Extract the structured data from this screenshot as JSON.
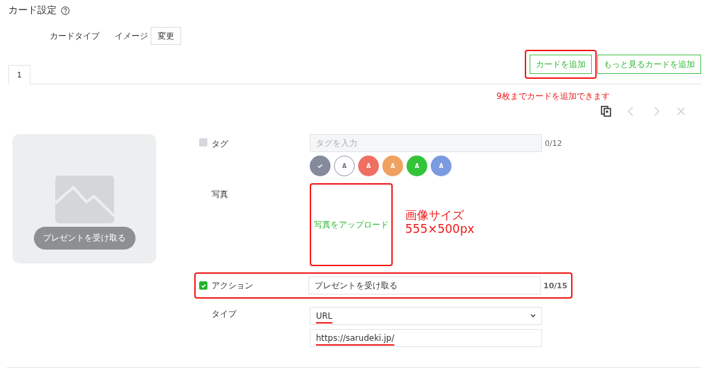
{
  "title": "カード設定",
  "card_type": {
    "label": "カードタイプ",
    "value": "イメージ",
    "change_button": "変更"
  },
  "tabs": [
    {
      "label": "1",
      "selected": true
    }
  ],
  "add_buttons": [
    {
      "label": "カードを追加",
      "highlighted": true
    },
    {
      "label": "もっと見るカードを追加",
      "highlighted": false
    }
  ],
  "add_note": "9枚までカードを追加できます",
  "preview": {
    "button": "プレゼントを受け取る"
  },
  "tag": {
    "label": "タグ",
    "checked": false,
    "placeholder": "タグを入力",
    "counter": "0/12",
    "colors": [
      {
        "color": "#858b9c",
        "selected": true
      },
      {
        "color": "#ffffff",
        "selected": false,
        "letter": "A"
      },
      {
        "color": "#ef6f63",
        "selected": false,
        "letter": "A"
      },
      {
        "color": "#f0a060",
        "selected": false,
        "letter": "A"
      },
      {
        "color": "#33c43a",
        "selected": false,
        "letter": "A"
      },
      {
        "color": "#7b9be0",
        "selected": false,
        "letter": "A"
      }
    ]
  },
  "photo": {
    "label": "写真",
    "upload": "写真をアップロード",
    "highlighted": true,
    "note": [
      "画像サイズ",
      "555×500px"
    ]
  },
  "action": {
    "label": "アクション",
    "checked": true,
    "value": "プレゼントを受け取る",
    "counter": "10/15",
    "highlighted": true
  },
  "type": {
    "label": "タイプ",
    "value": "URL",
    "underlined": true,
    "url": "https://sarudeki.jp/",
    "url_underlined": true
  }
}
